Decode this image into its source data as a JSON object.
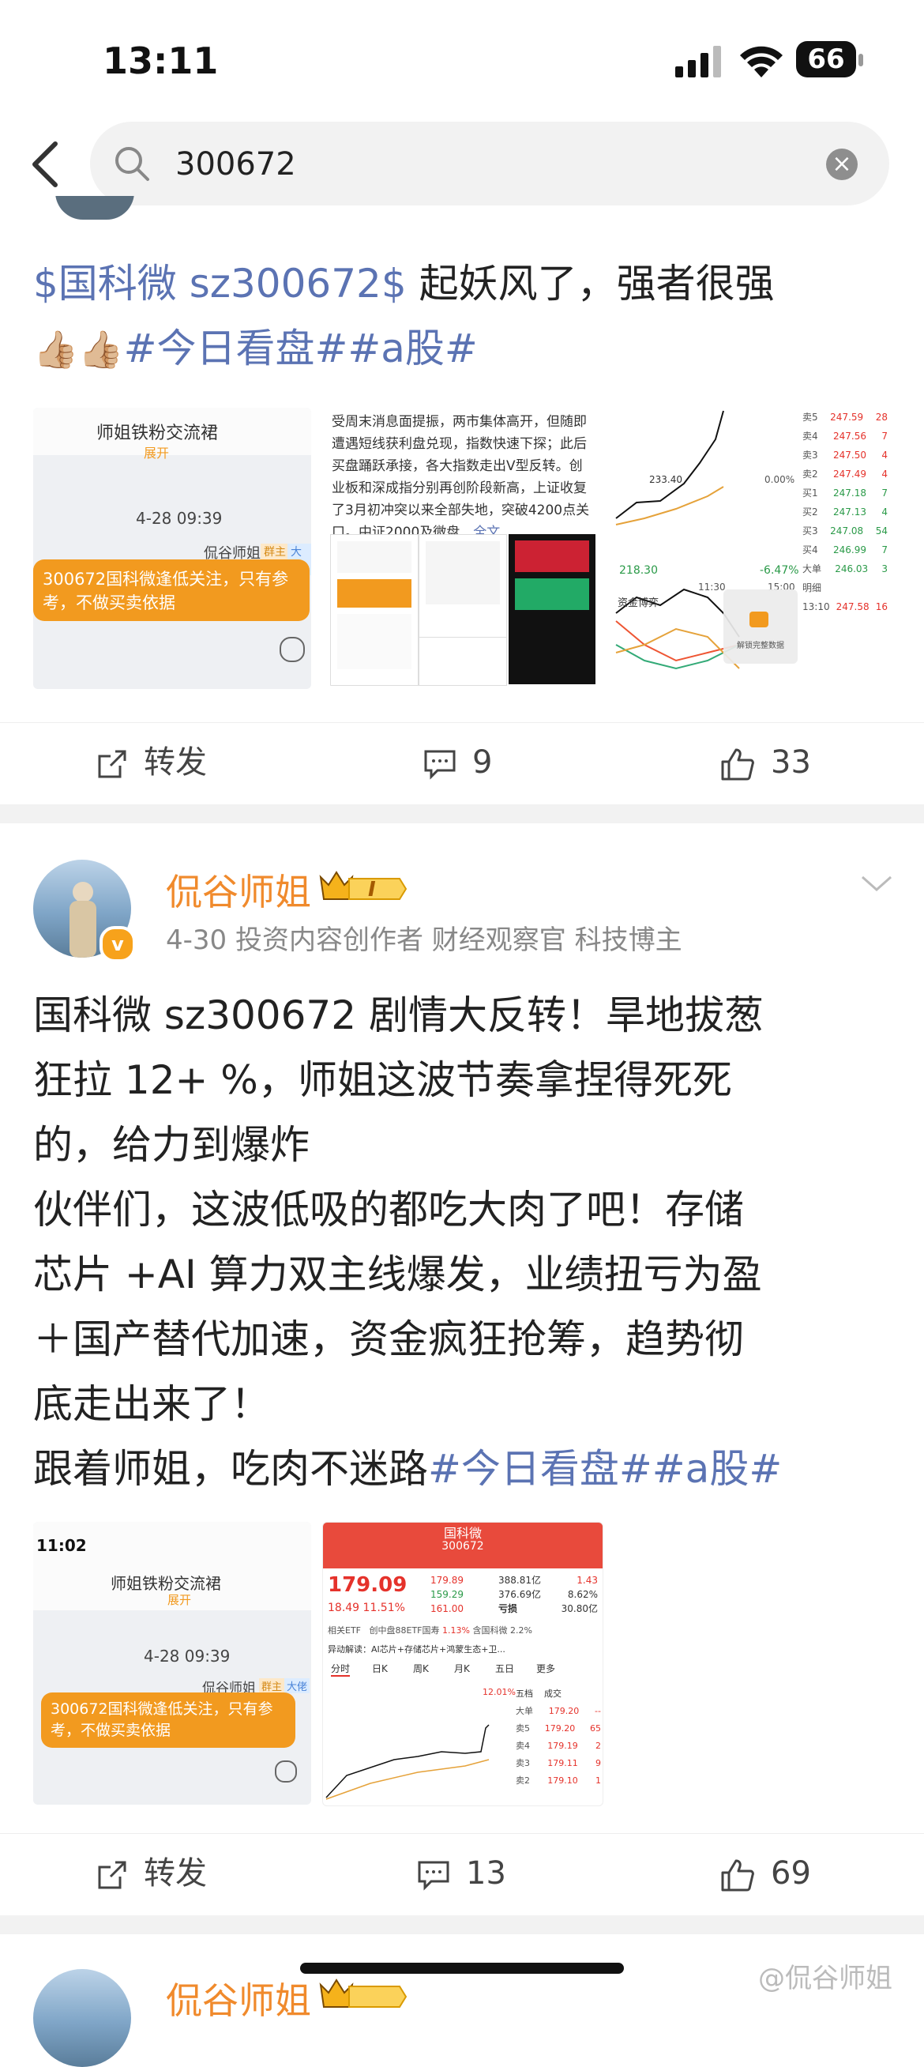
{
  "status": {
    "time": "13:11",
    "battery": "66"
  },
  "search": {
    "query": "300672"
  },
  "post1": {
    "text_main": "$国科微 sz300672$ 起妖风了，强者很强",
    "emojis": "👍🏼👍🏼",
    "tags": "#今日看盘##a股#",
    "img1": {
      "group": "师姐铁粉交流裙",
      "expand": "展开",
      "time": "4-28 09:39",
      "sender": "侃谷师姐",
      "badge1": "群主",
      "badge2": "大佬",
      "msg": "300672国科微逢低关注，只有参考，不做买卖依据"
    },
    "img2": {
      "text": "受周末消息面提振，两市集体高开，但随即遭遇短线获利盘兑现，指数快速下探；此后买盘踊跃承接，各大指数走出V型反转。创业板和深成指分别再创阶段新高，上证收复了3月初冲突以来全部失地，突破4200点关口。中证2000及微盘…",
      "more": "全文"
    },
    "img3": {
      "p1": "233.40",
      "p2": "218.30",
      "pct1": "0.00%",
      "pct2": "-6.47%",
      "t1": "11:30",
      "t2": "15:00",
      "flow": "资金博弈",
      "lock": "解锁完整数据",
      "orders": [
        [
          "卖5",
          "247.59",
          "28"
        ],
        [
          "卖4",
          "247.56",
          "7"
        ],
        [
          "卖3",
          "247.50",
          "4"
        ],
        [
          "卖2",
          "247.49",
          "4"
        ],
        [
          "买1",
          "247.18",
          "7"
        ],
        [
          "买2",
          "247.13",
          "4"
        ],
        [
          "买3",
          "247.08",
          "54"
        ],
        [
          "买4",
          "246.99",
          "7"
        ],
        [
          "大单",
          "246.03",
          "3"
        ],
        [
          "明细",
          "",
          ""
        ],
        [
          "13:10",
          "247.58",
          "16"
        ]
      ]
    },
    "forward": "转发",
    "comments": "9",
    "likes": "33"
  },
  "post2": {
    "name": "侃谷师姐",
    "meta": "4-30  投资内容创作者 财经观察官 科技博主",
    "level": "I",
    "lines": [
      "国科微 sz300672 剧情大反转！旱地拔葱",
      "狂拉 12+ %，师姐这波节奏拿捏得死死",
      "的，给力到爆炸",
      "伙伴们，这波低吸的都吃大肉了吧！存储",
      "芯片 +AI 算力双主线爆发，业绩扭亏为盈",
      "＋国产替代加速，资金疯狂抢筹，趋势彻",
      "底走出来了！"
    ],
    "last_line": "跟着师姐，吃肉不迷路",
    "tags": "#今日看盘##a股#",
    "img1": {
      "time": "11:02",
      "group": "师姐铁粉交流裙",
      "expand": "展开",
      "date": "4-28 09:39",
      "sender": "侃谷师姐",
      "badge1": "群主",
      "badge2": "大佬",
      "msg": "300672国科微逢低关注，只有参考，不做买卖依据"
    },
    "img2": {
      "title": "国科微",
      "code": "300672",
      "price": "179.09",
      "chg": "18.49",
      "pct": "11.51%",
      "hi": "179.89",
      "lo": "159.29",
      "open": "161.00",
      "cap": "388.81亿",
      "flow": "376.69亿",
      "pe": "亏损",
      "vr": "1.43",
      "turnover": "8.62%",
      "amount": "30.80亿",
      "etf": "相关ETF",
      "etf_name": "创中盘88ETF国寿",
      "etf_pct": "1.13%",
      "extra": "含国科微 2.2%",
      "news": "异动解读：AI芯片+存储芯片+鸿蒙生态+卫...",
      "tabs": [
        "分时",
        "日K",
        "周K",
        "月K",
        "五日",
        "更多"
      ],
      "pct_line": "12.01%",
      "ob_title": "五档",
      "ob_title2": "成交",
      "ob": [
        [
          "大单",
          "179.20",
          "--"
        ],
        [
          "卖5",
          "179.20",
          "65"
        ],
        [
          "卖4",
          "179.19",
          "2"
        ],
        [
          "卖3",
          "179.11",
          "9"
        ],
        [
          "卖2",
          "179.10",
          "1"
        ]
      ]
    },
    "forward": "转发",
    "comments": "13",
    "likes": "69"
  },
  "post3": {
    "name": "侃谷师姐"
  },
  "watermark": "@侃谷师姐"
}
